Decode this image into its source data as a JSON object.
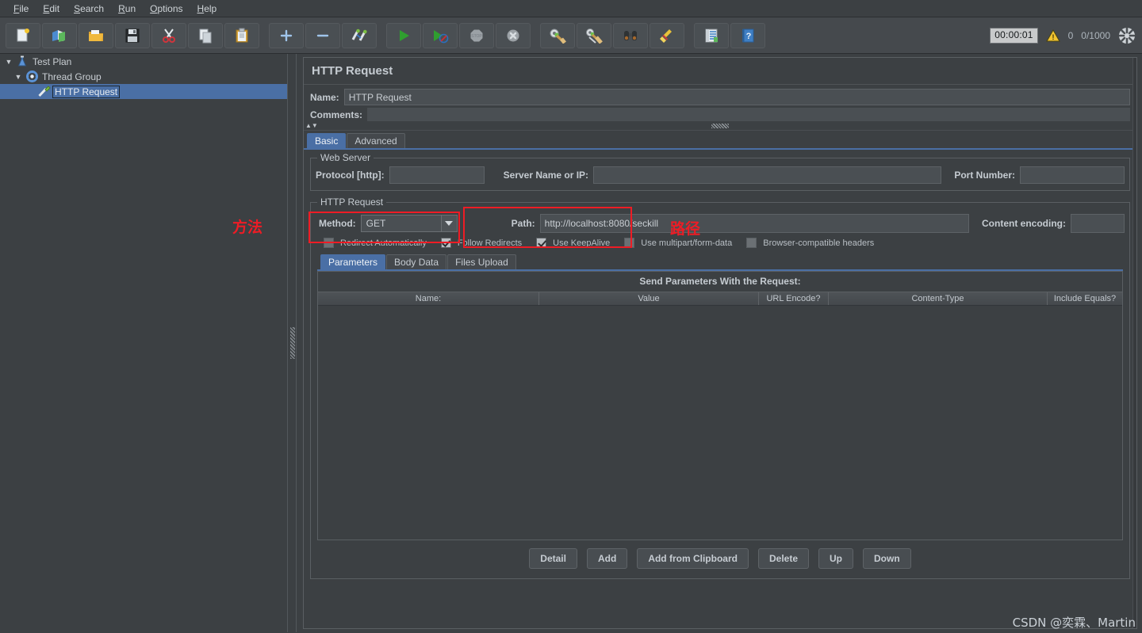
{
  "menubar": {
    "items": [
      {
        "label": "File",
        "mnemonic": "F"
      },
      {
        "label": "Edit",
        "mnemonic": "E"
      },
      {
        "label": "Search",
        "mnemonic": "S"
      },
      {
        "label": "Run",
        "mnemonic": "R"
      },
      {
        "label": "Options",
        "mnemonic": "O"
      },
      {
        "label": "Help",
        "mnemonic": "H"
      }
    ]
  },
  "toolbar": {
    "buttons": [
      {
        "name": "new-icon",
        "tooltip": "New"
      },
      {
        "name": "templates-icon",
        "tooltip": "Templates"
      },
      {
        "name": "open-icon",
        "tooltip": "Open"
      },
      {
        "name": "save-icon",
        "tooltip": "Save Test Plan"
      },
      {
        "name": "cut-icon",
        "tooltip": "Cut"
      },
      {
        "name": "copy-icon",
        "tooltip": "Copy"
      },
      {
        "name": "paste-icon",
        "tooltip": "Paste"
      },
      {
        "name": "expand-icon",
        "tooltip": "Expand All"
      },
      {
        "name": "collapse-icon",
        "tooltip": "Collapse All"
      },
      {
        "name": "toggle-icon",
        "tooltip": "Toggle"
      },
      {
        "name": "start-icon",
        "tooltip": "Start"
      },
      {
        "name": "start-no-pauses-icon",
        "tooltip": "Start no pauses"
      },
      {
        "name": "stop-icon",
        "tooltip": "Stop"
      },
      {
        "name": "shutdown-icon",
        "tooltip": "Shutdown"
      },
      {
        "name": "clear-icon",
        "tooltip": "Clear"
      },
      {
        "name": "clear-all-icon",
        "tooltip": "Clear All"
      },
      {
        "name": "search-icon",
        "tooltip": "Search"
      },
      {
        "name": "reset-search-icon",
        "tooltip": "Reset Search"
      },
      {
        "name": "function-helper-icon",
        "tooltip": "Function Helper Dialog"
      },
      {
        "name": "help-icon",
        "tooltip": "Help"
      }
    ],
    "timer": "00:00:01",
    "warning_count": "0",
    "thread_count": "0/1000"
  },
  "tree": {
    "nodes": [
      {
        "label": "Test Plan",
        "icon": "test-plan-icon",
        "expanded": true,
        "depth": 0,
        "selected": false
      },
      {
        "label": "Thread Group",
        "icon": "thread-group-icon",
        "expanded": true,
        "depth": 1,
        "selected": false
      },
      {
        "label": "HTTP Request",
        "icon": "http-request-icon",
        "expanded": null,
        "depth": 2,
        "selected": true
      }
    ]
  },
  "panel": {
    "title": "HTTP Request",
    "name_label": "Name:",
    "name_value": "HTTP Request",
    "comments_label": "Comments:",
    "comments_value": "",
    "tabs": [
      {
        "label": "Basic",
        "active": true
      },
      {
        "label": "Advanced",
        "active": false
      }
    ],
    "web_server": {
      "group_title": "Web Server",
      "protocol_label": "Protocol [http]:",
      "protocol_value": "",
      "server_label": "Server Name or IP:",
      "server_value": "",
      "port_label": "Port Number:",
      "port_value": ""
    },
    "http_request": {
      "group_title": "HTTP Request",
      "method_label": "Method:",
      "method_value": "GET",
      "path_label": "Path:",
      "path_value": "http://localhost:8080/seckill",
      "content_encoding_label": "Content encoding:",
      "content_encoding_value": "",
      "checkboxes": [
        {
          "label": "Redirect Automatically",
          "checked": false
        },
        {
          "label": "Follow Redirects",
          "checked": true
        },
        {
          "label": "Use KeepAlive",
          "checked": true
        },
        {
          "label": "Use multipart/form-data",
          "checked": false
        },
        {
          "label": "Browser-compatible headers",
          "checked": false
        }
      ]
    },
    "param_tabs": [
      {
        "label": "Parameters",
        "active": true
      },
      {
        "label": "Body Data",
        "active": false
      },
      {
        "label": "Files Upload",
        "active": false
      }
    ],
    "param_table": {
      "caption": "Send Parameters With the Request:",
      "columns": [
        "Name:",
        "Value",
        "URL Encode?",
        "Content-Type",
        "Include Equals?"
      ],
      "rows": []
    },
    "buttons": [
      {
        "label": "Detail"
      },
      {
        "label": "Add"
      },
      {
        "label": "Add from Clipboard"
      },
      {
        "label": "Delete"
      },
      {
        "label": "Up"
      },
      {
        "label": "Down"
      }
    ]
  },
  "annotations": [
    {
      "name": "method-annotation",
      "text": "方法",
      "color": "#ee1c25"
    },
    {
      "name": "path-annotation",
      "text": "路径",
      "color": "#ee1c25"
    }
  ],
  "watermark": "CSDN @奕霖、Martin",
  "colors": {
    "background": "#3c4043",
    "panel": "#45494d",
    "field": "#4a4f53",
    "accent": "#4a6fa5",
    "text": "#c5cbd1",
    "annotation_red": "#ee1c25"
  }
}
